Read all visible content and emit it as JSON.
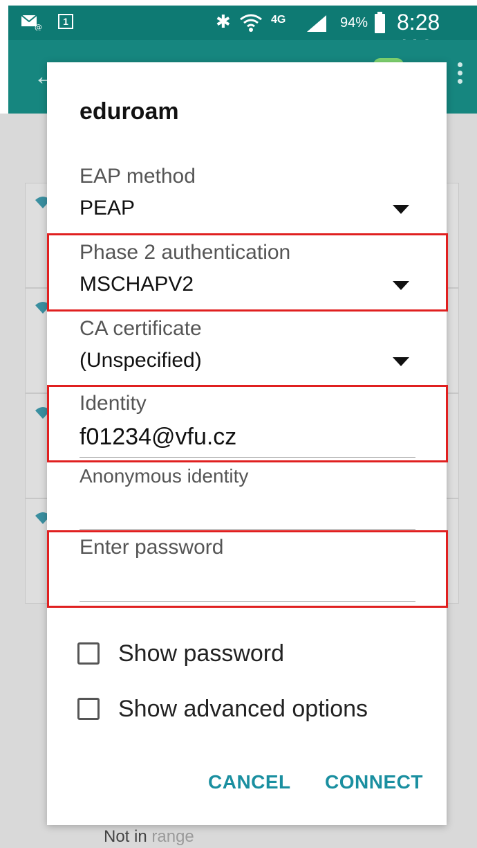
{
  "status_bar": {
    "battery_percent": "94%",
    "time": "8:28 AM",
    "network_type": "4G",
    "icons": [
      "mail-icon",
      "calendar-icon",
      "bluetooth-icon",
      "wifi-icon",
      "lte-icon",
      "signal-icon",
      "battery-icon"
    ]
  },
  "background": {
    "not_in_range_prefix": "Not in ",
    "not_in_range_suffix": "range"
  },
  "dialog": {
    "title": "eduroam",
    "fields": {
      "eap_method": {
        "label": "EAP method",
        "value": "PEAP"
      },
      "phase2": {
        "label": "Phase 2 authentication",
        "value": "MSCHAPV2"
      },
      "ca_certificate": {
        "label": "CA certificate",
        "value": "(Unspecified)"
      },
      "identity": {
        "label": "Identity",
        "value": "f01234@vfu.cz"
      },
      "anonymous_identity": {
        "label": "Anonymous identity",
        "value": ""
      },
      "password": {
        "label": "Enter password",
        "value": ""
      }
    },
    "checkboxes": {
      "show_password": {
        "label": "Show password",
        "checked": false
      },
      "show_advanced": {
        "label": "Show advanced options",
        "checked": false
      }
    },
    "buttons": {
      "cancel": "CANCEL",
      "connect": "CONNECT"
    }
  },
  "colors": {
    "status_bar": "#0e7a73",
    "app_bar": "#16867f",
    "accent_button": "#1a8fa0",
    "highlight": "#e02020"
  }
}
